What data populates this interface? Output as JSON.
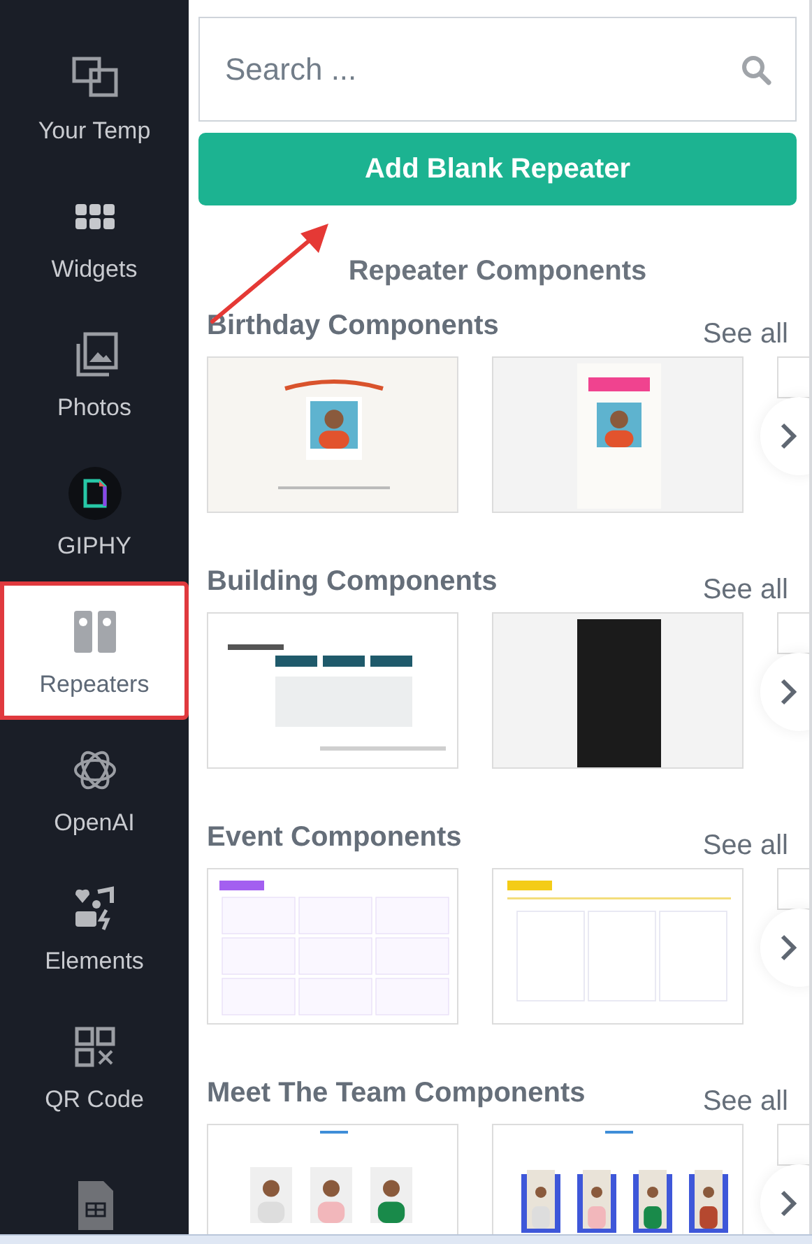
{
  "sidebar": {
    "items": [
      {
        "label": "Your Temp",
        "selected": false
      },
      {
        "label": "Widgets",
        "selected": false
      },
      {
        "label": "Photos",
        "selected": false
      },
      {
        "label": "GIPHY",
        "selected": false
      },
      {
        "label": "Repeaters",
        "selected": true
      },
      {
        "label": "OpenAI",
        "selected": false
      },
      {
        "label": "Elements",
        "selected": false
      },
      {
        "label": "QR Code",
        "selected": false
      },
      {
        "selected": false
      }
    ]
  },
  "search": {
    "placeholder": "Search ..."
  },
  "add_button": "Add Blank Repeater",
  "heading": "Repeater Components",
  "sections": [
    {
      "title": "Birthday Components",
      "see_all": "See all"
    },
    {
      "title": "Building Components",
      "see_all": "See all"
    },
    {
      "title": "Event Components",
      "see_all": "See all"
    },
    {
      "title": "Meet The Team Components",
      "see_all": "See all"
    }
  ]
}
